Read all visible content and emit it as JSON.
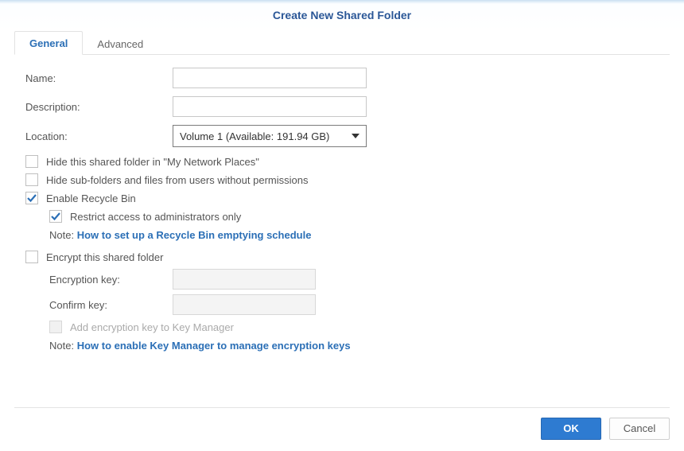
{
  "dialog": {
    "title": "Create New Shared Folder"
  },
  "tabs": {
    "general": "General",
    "advanced": "Advanced"
  },
  "form": {
    "name_label": "Name:",
    "name_value": "",
    "description_label": "Description:",
    "description_value": "",
    "location_label": "Location:",
    "location_value": "Volume 1 (Available: 191.94 GB)",
    "hide_network_places": "Hide this shared folder in \"My Network Places\"",
    "hide_subfolders": "Hide sub-folders and files from users without permissions",
    "enable_recycle": "Enable Recycle Bin",
    "restrict_admins": "Restrict access to administrators only",
    "recycle_note_prefix": "Note: ",
    "recycle_note_link": "How to set up a Recycle Bin emptying schedule",
    "encrypt_folder": "Encrypt this shared folder",
    "encryption_key_label": "Encryption key:",
    "confirm_key_label": "Confirm key:",
    "add_key_manager": "Add encryption key to Key Manager",
    "keymgr_note_prefix": "Note: ",
    "keymgr_note_link": "How to enable Key Manager to manage encryption keys"
  },
  "buttons": {
    "ok": "OK",
    "cancel": "Cancel"
  }
}
